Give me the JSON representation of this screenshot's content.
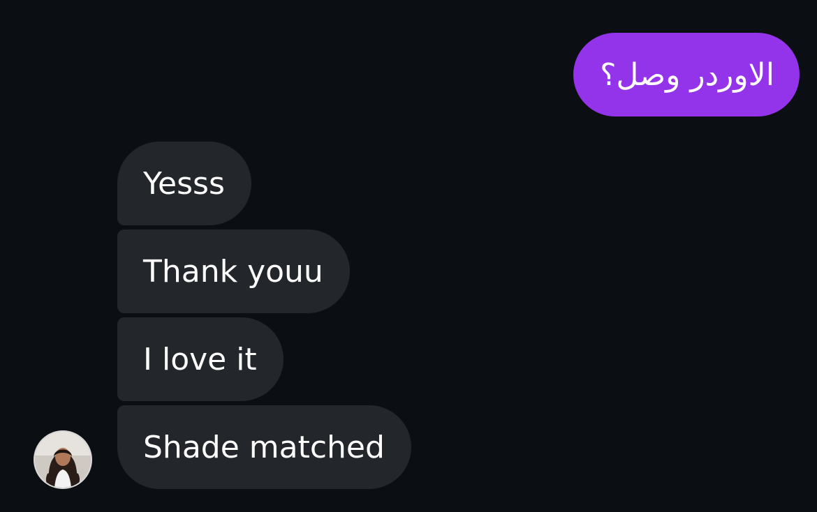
{
  "conversation": {
    "messages": [
      {
        "direction": "sent",
        "text": "الاوردر وصل؟"
      },
      {
        "direction": "received",
        "text": "Yesss"
      },
      {
        "direction": "received",
        "text": "Thank youu"
      },
      {
        "direction": "received",
        "text": "I love it"
      },
      {
        "direction": "received",
        "text": "Shade matched"
      }
    ],
    "contact": {
      "avatar_description": "profile photo of contact"
    }
  },
  "colors": {
    "background": "#0b0f14",
    "sent_bubble": "#9333ea",
    "received_bubble": "#23272c",
    "text": "#ffffff"
  }
}
